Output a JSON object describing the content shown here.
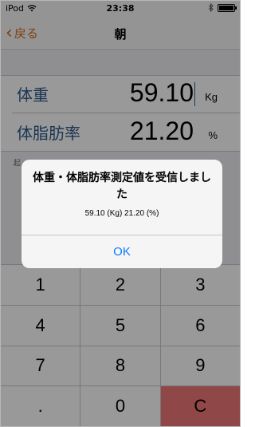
{
  "status_bar": {
    "carrier": "iPod",
    "time": "23:38",
    "bluetooth_icon": "bluetooth-icon",
    "wifi_icon": "wifi-icon",
    "battery_icon": "battery-icon"
  },
  "nav": {
    "back_label": "戻る",
    "title": "朝",
    "back_icon": "chevron-left-icon",
    "accent_color": "#d2691e"
  },
  "measurements": {
    "weight": {
      "label": "体重",
      "value": "59.10",
      "unit": "Kg"
    },
    "body_fat": {
      "label": "体脂肪率",
      "value": "21.20",
      "unit": "%"
    }
  },
  "hint": "起",
  "keypad": {
    "keys": [
      "1",
      "2",
      "3",
      "4",
      "5",
      "6",
      "7",
      "8",
      "9",
      ".",
      "0",
      "C"
    ],
    "clear_color": "#ee7777"
  },
  "alert": {
    "title": "体重・体脂肪率測定値を受信しました",
    "message": "59.10 (Kg) 21.20 (%)",
    "ok_label": "OK",
    "button_color": "#0a7aff"
  }
}
